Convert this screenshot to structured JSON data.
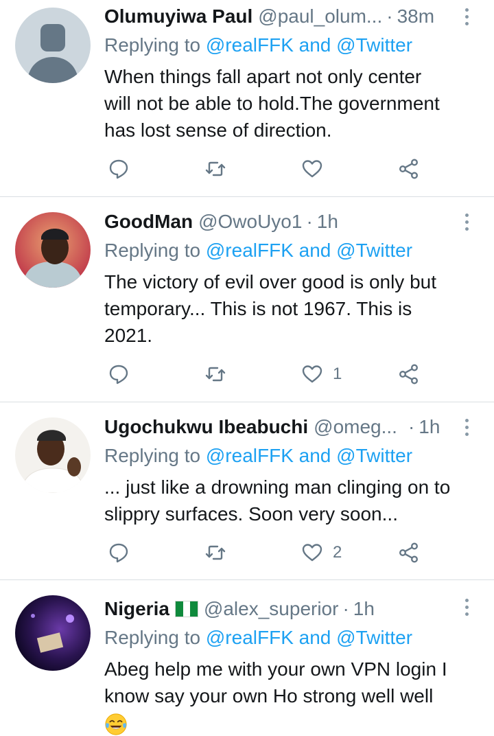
{
  "reply_prefix": "Replying to",
  "reply_targets": "@realFFK and @Twitter",
  "tweets": [
    {
      "name": "Olumuyiwa Paul",
      "handle": "@paul_olum...",
      "sep": "·",
      "time": "38m",
      "text_lines": [
        "When things fall apart not only center",
        "will not be able to hold.The government",
        "has lost sense of direction."
      ],
      "like_count": ""
    },
    {
      "name": "GoodMan",
      "handle": "@OwoUyo1",
      "sep": "·",
      "time": "1h",
      "text_lines": [
        "The victory of evil over good is only but",
        "temporary... This is not 1967. This is",
        "2021."
      ],
      "like_count": "1"
    },
    {
      "name": "Ugochukwu Ibeabuchi",
      "handle": "@omeg...",
      "sep": "·",
      "time": "1h",
      "text_lines": [
        "... just like a drowning man clinging on to",
        "slippry surfaces. Soon very soon..."
      ],
      "like_count": "2"
    },
    {
      "name": "Nigeria",
      "handle": "@alex_superior",
      "sep": "·",
      "time": "1h",
      "text_lines": [
        "Abeg help me with your own VPN login I",
        "know say your own Ho strong well well"
      ],
      "like_count": ""
    }
  ],
  "icons": {
    "reply": "speech-bubble-icon",
    "retweet": "retweet-icon",
    "like": "heart-icon",
    "share": "share-icon",
    "more": "vertical-ellipsis-icon",
    "flag": "nigeria-flag-icon",
    "emoji": "tears-of-joy-emoji"
  },
  "colors": {
    "link": "#1da1f2",
    "muted": "#657786",
    "text": "#14171a",
    "divider": "#d9dee2",
    "flag_green": "#0f8a3c"
  }
}
